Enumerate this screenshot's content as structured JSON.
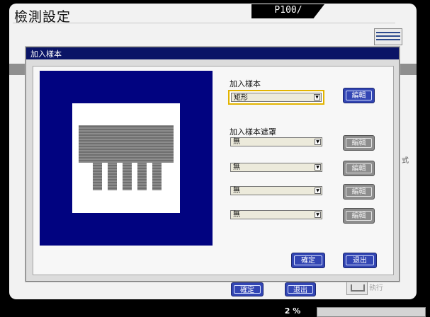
{
  "main_window": {
    "title": "檢測設定",
    "tab_label": "P100/",
    "side_text": "式",
    "print_label": "執行",
    "confirm_label": "確定",
    "exit_label": "退出"
  },
  "dialog": {
    "title": "加入樣本",
    "sample_section_label": "加入樣本",
    "sample_select_value": "矩形",
    "edit_label": "編輯",
    "mask_section_label": "加入樣本遮罩",
    "mask_rows": [
      {
        "value": "無",
        "edit_label": "編輯"
      },
      {
        "value": "無",
        "edit_label": "編輯"
      },
      {
        "value": "無",
        "edit_label": "編輯"
      },
      {
        "value": "無",
        "edit_label": "編輯"
      }
    ],
    "confirm_label": "確定",
    "exit_label": "退出"
  },
  "status_bar": {
    "percent": "2 %"
  },
  "colors": {
    "titlebar": "#0a1466",
    "preview_bg": "#010380",
    "button_blue": "#3245b3",
    "focus_outline": "#e2b400"
  },
  "icons": [
    "dropdown-arrow-icon",
    "panel-icon",
    "printer-icon"
  ]
}
